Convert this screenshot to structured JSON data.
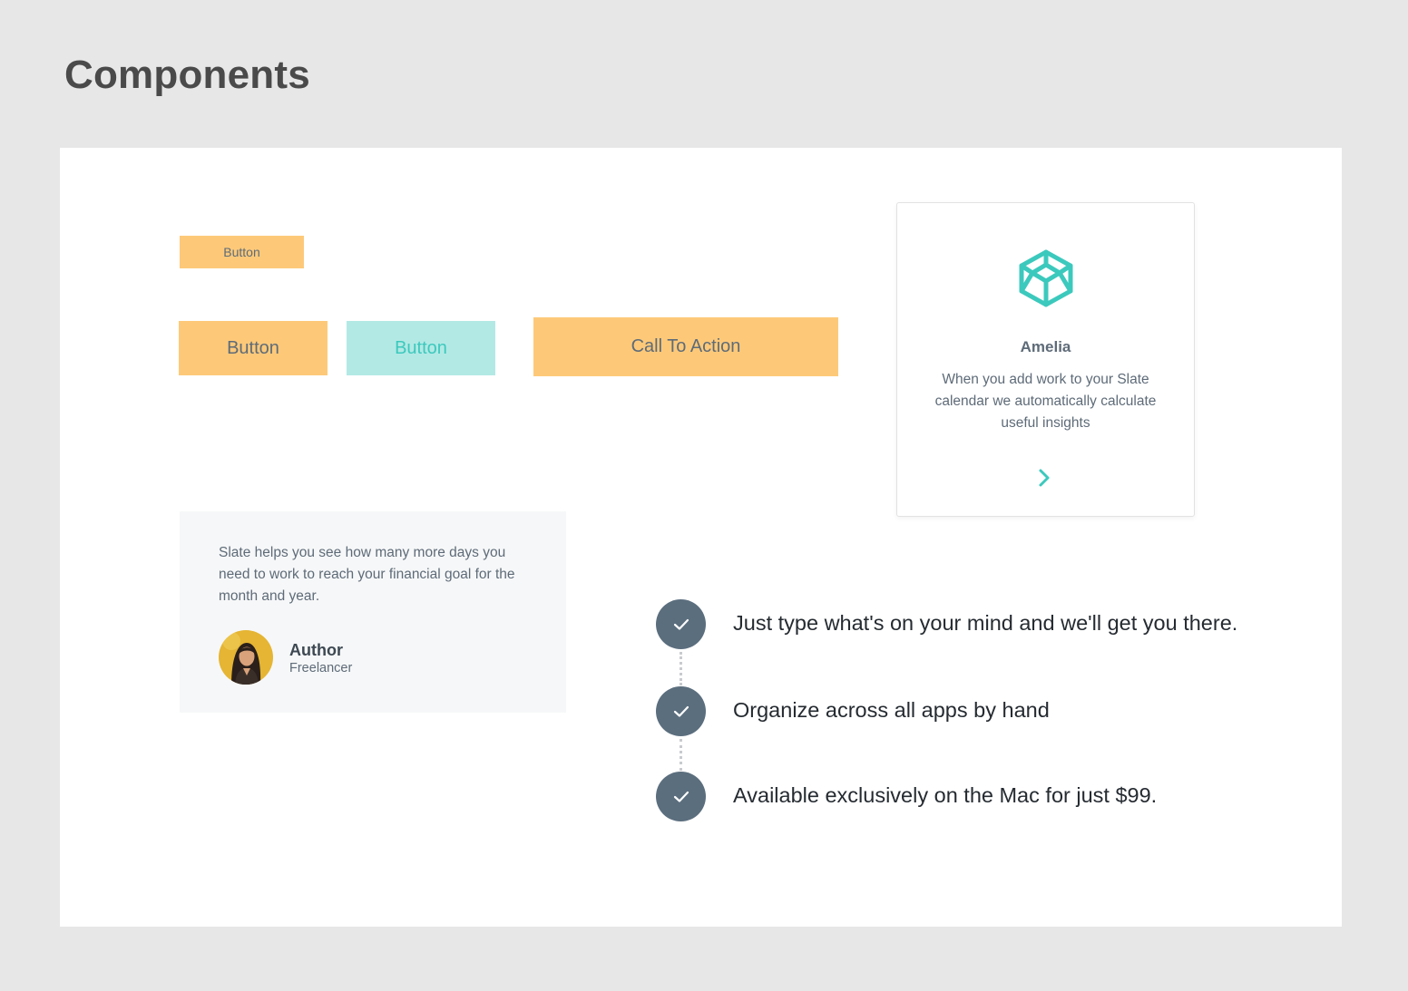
{
  "page": {
    "title": "Components"
  },
  "buttons": {
    "small_label": "Button",
    "primary_label": "Button",
    "secondary_label": "Button",
    "cta_label": "Call To Action"
  },
  "profile_card": {
    "logo_icon": "codepen-cube-icon",
    "name": "Amelia",
    "description": "When you add work to your Slate calendar we automatically calculate useful insights",
    "arrow_icon": "chevron-right-icon"
  },
  "testimonial": {
    "text": "Slate helps you see how many more days you need to work to reach your financial goal for the month and year.",
    "author_name": "Author",
    "author_role": "Freelancer"
  },
  "checklist": {
    "icon": "check-icon",
    "items": [
      "Just type what's on your mind and we'll get you there.",
      "Organize across all apps by hand",
      "Available exclusively on the Mac for just $99."
    ]
  },
  "colors": {
    "background": "#e7e7e7",
    "canvas": "#ffffff",
    "orange": "#fdc979",
    "teal_light": "#b3e9e5",
    "teal": "#3cc9bd",
    "slate": "#5b6e7e",
    "text_gray": "#5e6b78"
  }
}
